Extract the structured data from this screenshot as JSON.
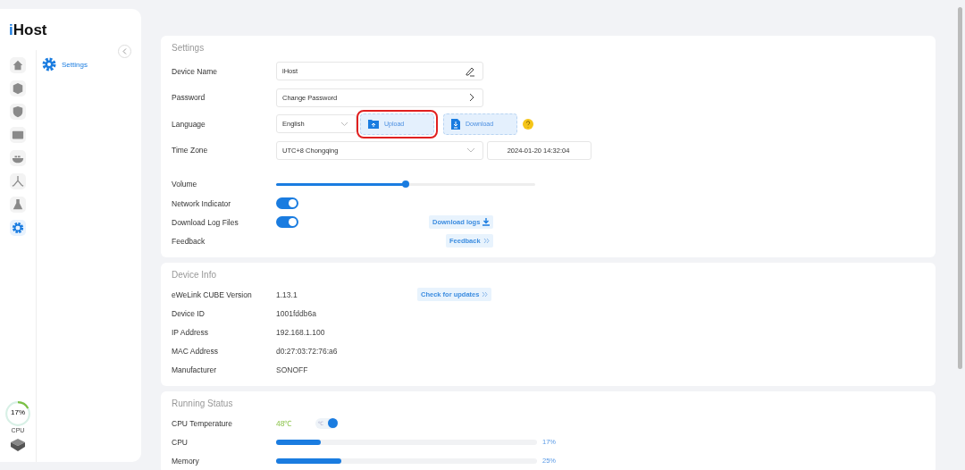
{
  "sidebar": {
    "logo_accent": "i",
    "logo_rest": "Host",
    "nav": [
      {
        "kind": "home",
        "selected": false
      },
      {
        "kind": "cube",
        "selected": false
      },
      {
        "kind": "shield",
        "selected": false
      },
      {
        "kind": "panel",
        "selected": false
      },
      {
        "kind": "docker",
        "selected": false
      },
      {
        "kind": "nodes",
        "selected": false
      },
      {
        "kind": "flask",
        "selected": false
      },
      {
        "kind": "gear",
        "selected": true
      }
    ],
    "submenu": [
      {
        "label": "Settings",
        "selected": true
      }
    ],
    "cpu_gauge": {
      "value": "17%",
      "label": "CPU",
      "level": 0.17
    }
  },
  "settings": {
    "title": "Settings",
    "device_name": {
      "label": "Device Name",
      "value": "iHost"
    },
    "password": {
      "label": "Password",
      "value": "Change Password"
    },
    "language": {
      "label": "Language",
      "value": "English",
      "upload": "Upload",
      "download": "Download",
      "upload_highlighted": true
    },
    "time_zone": {
      "label": "Time Zone",
      "value": "UTC+8 Chongqing",
      "datetime": "2024-01-20 14:32:04"
    },
    "volume": {
      "label": "Volume",
      "level": 0.5
    },
    "toggles": [
      {
        "label": "Network Indicator",
        "on": true
      },
      {
        "label": "Download Log Files",
        "on": true,
        "action": "Download logs"
      }
    ],
    "feedback": {
      "label": "Feedback",
      "action": "Feedback"
    }
  },
  "device_info": {
    "title": "Device Info",
    "rows": [
      {
        "label": "eWeLink CUBE Version",
        "value": "1.13.1",
        "action": "Check for updates"
      },
      {
        "label": "Device ID",
        "value": "1001fddb6a"
      },
      {
        "label": "IP Address",
        "value": "192.168.1.100"
      },
      {
        "label": "MAC Address",
        "value": "d0:27:03:72:76:a6"
      },
      {
        "label": "Manufacturer",
        "value": "SONOFF"
      }
    ]
  },
  "running_status": {
    "title": "Running Status",
    "temperature": {
      "label": "CPU Temperature",
      "value": "48℃",
      "unit": "℃",
      "on": true
    },
    "meters": [
      {
        "label": "CPU",
        "level": 0.17,
        "reading": "17%"
      },
      {
        "label": "Memory",
        "level": 0.25,
        "reading": "25%"
      }
    ]
  }
}
